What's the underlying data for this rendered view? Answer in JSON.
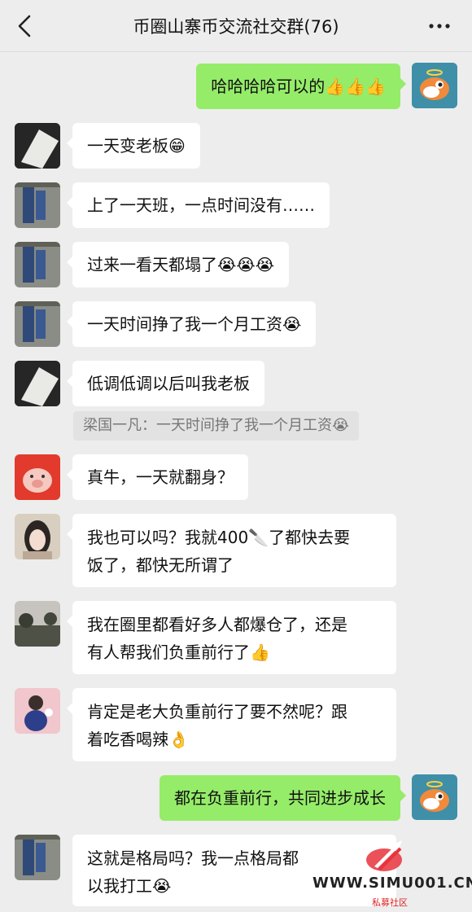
{
  "header": {
    "title": "币圈山寨币交流社交群(76)"
  },
  "messages": [
    {
      "from": "me",
      "text": "哈哈哈哈可以的👍👍👍"
    },
    {
      "from": "other",
      "text": "一天变老板😁"
    },
    {
      "from": "other",
      "text": "上了一天班，一点时间没有……"
    },
    {
      "from": "other",
      "text": "过来一看天都塌了😭😭😭"
    },
    {
      "from": "other",
      "text": "一天时间挣了我一个月工资😭"
    },
    {
      "from": "other",
      "text": "低调低调以后叫我老板"
    },
    {
      "from": "other",
      "text": "真牛，一天就翻身？"
    },
    {
      "from": "other",
      "text": "我也可以吗？我就400🔪了都快去要\n饭了，都快无所谓了"
    },
    {
      "from": "other",
      "text": "我在圈里都看好多人都爆仓了，还是\n有人帮我们负重前行了👍"
    },
    {
      "from": "other",
      "text": "肯定是老大负重前行了要不然呢？跟\n着吃香喝辣👌"
    },
    {
      "from": "me",
      "text": "都在负重前行，共同进步成长"
    },
    {
      "from": "other",
      "text": "这就是格局吗？我一点格局都\n以我打工😭"
    }
  ],
  "quote": {
    "text": "梁国一凡：一天时间挣了我一个月工资😭"
  },
  "watermark": {
    "site": "WWW.SIMU001.CN",
    "subtitle": "私募社区"
  },
  "colors": {
    "background": "#ededed",
    "self_bubble": "#95ec69",
    "other_bubble": "#ffffff",
    "watermark_red": "#e8333b"
  }
}
